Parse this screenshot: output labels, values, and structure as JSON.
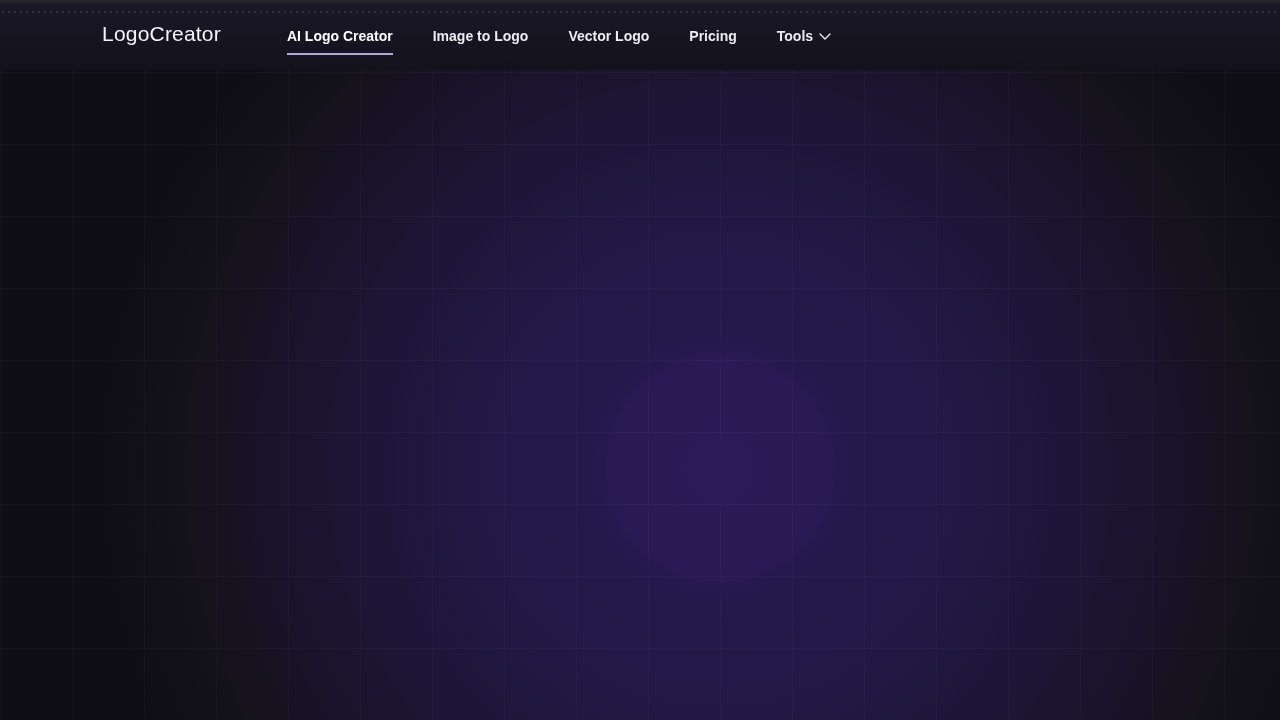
{
  "header": {
    "logo": "LogoCreator",
    "nav": [
      {
        "label": "AI Logo Creator",
        "selected": true,
        "has_menu": false
      },
      {
        "label": "Image to Logo",
        "selected": false,
        "has_menu": false
      },
      {
        "label": "Vector Logo",
        "selected": false,
        "has_menu": false
      },
      {
        "label": "Pricing",
        "selected": false,
        "has_menu": false
      },
      {
        "label": "Tools",
        "selected": false,
        "has_menu": true
      }
    ]
  }
}
